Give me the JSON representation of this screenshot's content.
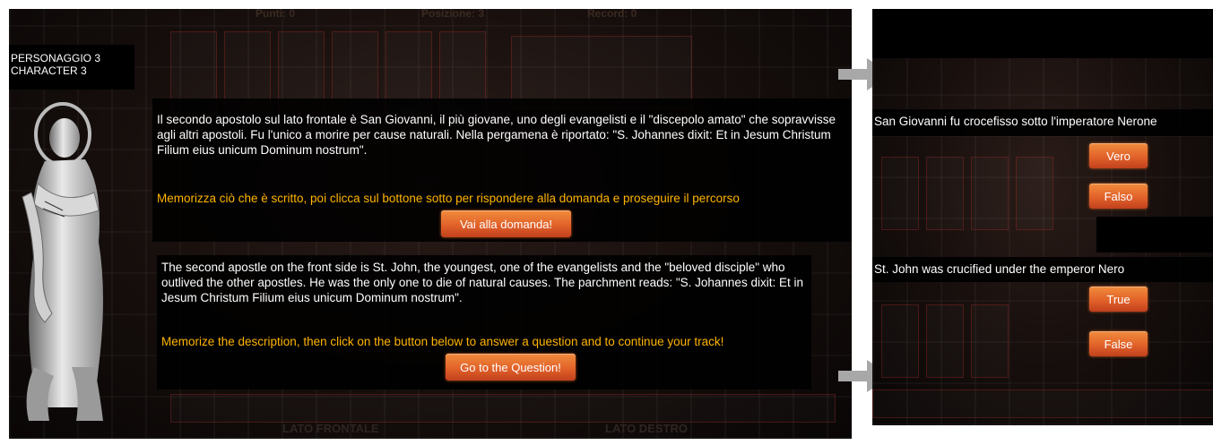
{
  "topbar": {
    "punti": "Punti: 0",
    "posizione": "Posizione: 3",
    "record": "Record: 0"
  },
  "character": {
    "label_it": "PERSONAGGIO 3",
    "label_en": "CHARACTER 3"
  },
  "italian": {
    "paragraph": "Il secondo apostolo sul lato frontale è San Giovanni, il più giovane, uno degli evangelisti e il \"discepolo amato\" che sopravvisse agli altri apostoli. Fu l'unico a morire per cause naturali. Nella pergamena è riportato: \"S. Johannes dixit: Et in Jesum Christum Filium eius unicum Dominum nostrum\".",
    "instruction": "Memorizza ciò che è scritto, poi clicca sul bottone sotto per rispondere alla domanda e proseguire il percorso",
    "button": "Vai alla domanda!"
  },
  "english": {
    "paragraph": "The second apostle on the front side is St. John, the youngest, one of the evangelists and the \"beloved disciple\" who outlived the other apostles. He was the only one to die of natural causes. The parchment reads: \"S. Johannes dixit: Et in Jesum Christum Filium eius unicum Dominum nostrum\".",
    "instruction": "Memorize the description, then click on the button below to answer a question and to continue your track!",
    "button": "Go to the Question!"
  },
  "footer": {
    "left": "LATO FRONTALE",
    "right": "LATO DESTRO"
  },
  "quiz": {
    "question_it": "San Giovanni fu crocefisso sotto l'imperatore Nerone",
    "true_it": "Vero",
    "false_it": "Falso",
    "question_en": "St. John was crucified under the emperor Nero",
    "true_en": "True",
    "false_en": "False"
  },
  "colors": {
    "accent_text": "#ffb400",
    "button": "#e2622a",
    "background": "#0a0707"
  }
}
